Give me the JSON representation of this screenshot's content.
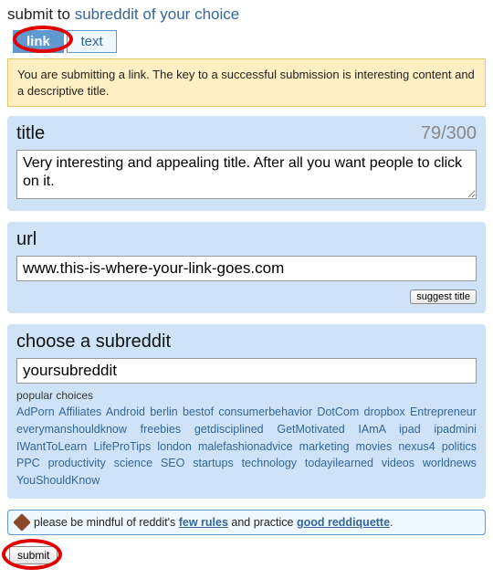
{
  "header": {
    "prefix": "submit to",
    "subreddit_link": "subreddit of your choice"
  },
  "tabs": {
    "link": "link",
    "text": "text"
  },
  "notice": "You are submitting a link. The key to a successful submission is interesting content and a descriptive title.",
  "title_panel": {
    "label": "title",
    "counter": "79/300",
    "value": "Very interesting and appealing title. After all you want people to click on it."
  },
  "url_panel": {
    "label": "url",
    "value": "www.this-is-where-your-link-goes.com",
    "suggest_button": "suggest title"
  },
  "subreddit_panel": {
    "label": "choose a subreddit",
    "value": "yoursubreddit",
    "popular_label": "popular choices",
    "popular": [
      "AdPorn",
      "Affiliates",
      "Android",
      "berlin",
      "bestof",
      "consumerbehavior",
      "DotCom",
      "dropbox",
      "Entrepreneur",
      "everymanshouldknow",
      "freebies",
      "getdisciplined",
      "GetMotivated",
      "IAmA",
      "ipad",
      "ipadmini",
      "IWantToLearn",
      "LifeProTips",
      "london",
      "malefashionadvice",
      "marketing",
      "movies",
      "nexus4",
      "politics",
      "PPC",
      "productivity",
      "science",
      "SEO",
      "startups",
      "technology",
      "todayilearned",
      "videos",
      "worldnews",
      "YouShouldKnow"
    ]
  },
  "reminder": {
    "prefix": "please be mindful of reddit's ",
    "rules_link": "few rules",
    "middle": " and practice ",
    "reddiquette_link": "good reddiquette",
    "suffix": "."
  },
  "submit_button": "submit"
}
